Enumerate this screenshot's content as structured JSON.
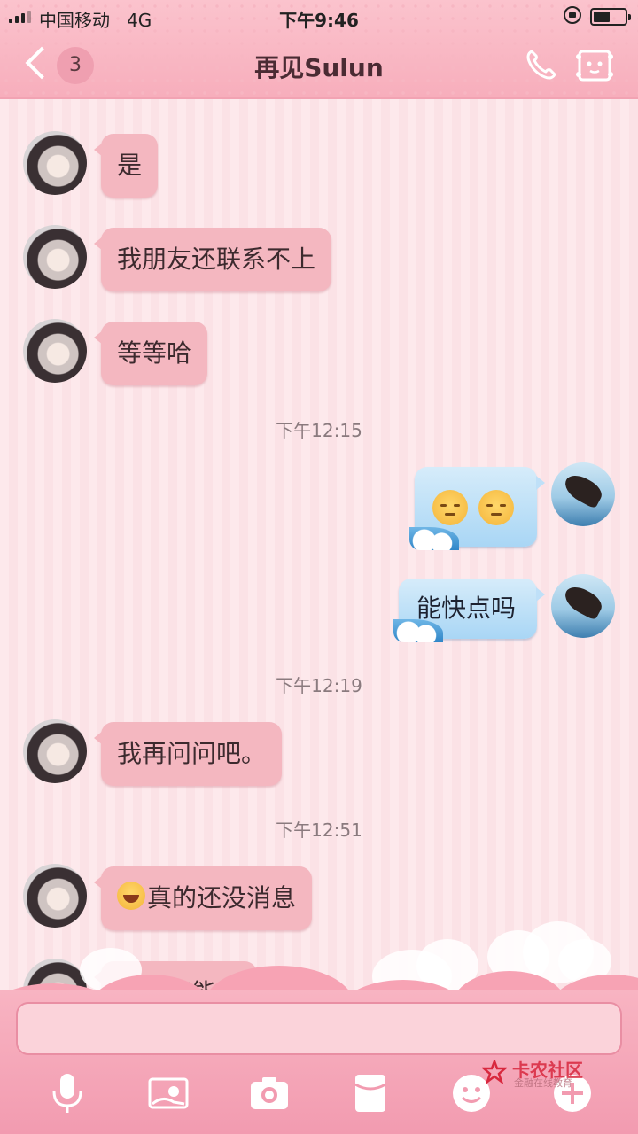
{
  "status_bar": {
    "carrier": "中国移动",
    "network": "4G",
    "time": "下午9:46"
  },
  "header": {
    "unread_count": "3",
    "contact_name": "再见Sulun"
  },
  "messages": [
    {
      "side": "left",
      "text": "是"
    },
    {
      "side": "left",
      "text": "我朋友还联系不上"
    },
    {
      "side": "left",
      "text": "等等哈"
    },
    {
      "timestamp": "下午12:15"
    },
    {
      "side": "right",
      "emoji": [
        "pensive-face",
        "pensive-face"
      ]
    },
    {
      "side": "right",
      "text": "能快点吗"
    },
    {
      "timestamp": "下午12:19"
    },
    {
      "side": "left",
      "text": "我再问问吧。"
    },
    {
      "timestamp": "下午12:51"
    },
    {
      "side": "left",
      "emoji_prefix": "face-with-tears-of-joy",
      "text": "真的还没消息"
    },
    {
      "side": "left",
      "text": "妈的真能吗",
      "partially_hidden": true
    }
  ],
  "composer": {
    "input_value": ""
  },
  "toolbar": {
    "icons": [
      "microphone-icon",
      "image-icon",
      "camera-icon",
      "red-packet-icon",
      "emoji-icon",
      "plus-icon"
    ]
  },
  "watermark": {
    "title": "卡农社区",
    "subtitle": "金融在线教育"
  },
  "colors": {
    "header_pink": "#f7aebc",
    "left_bubble": "#f4b7c0",
    "right_bubble": "#a9d6f5",
    "background": "#fde7ea"
  }
}
